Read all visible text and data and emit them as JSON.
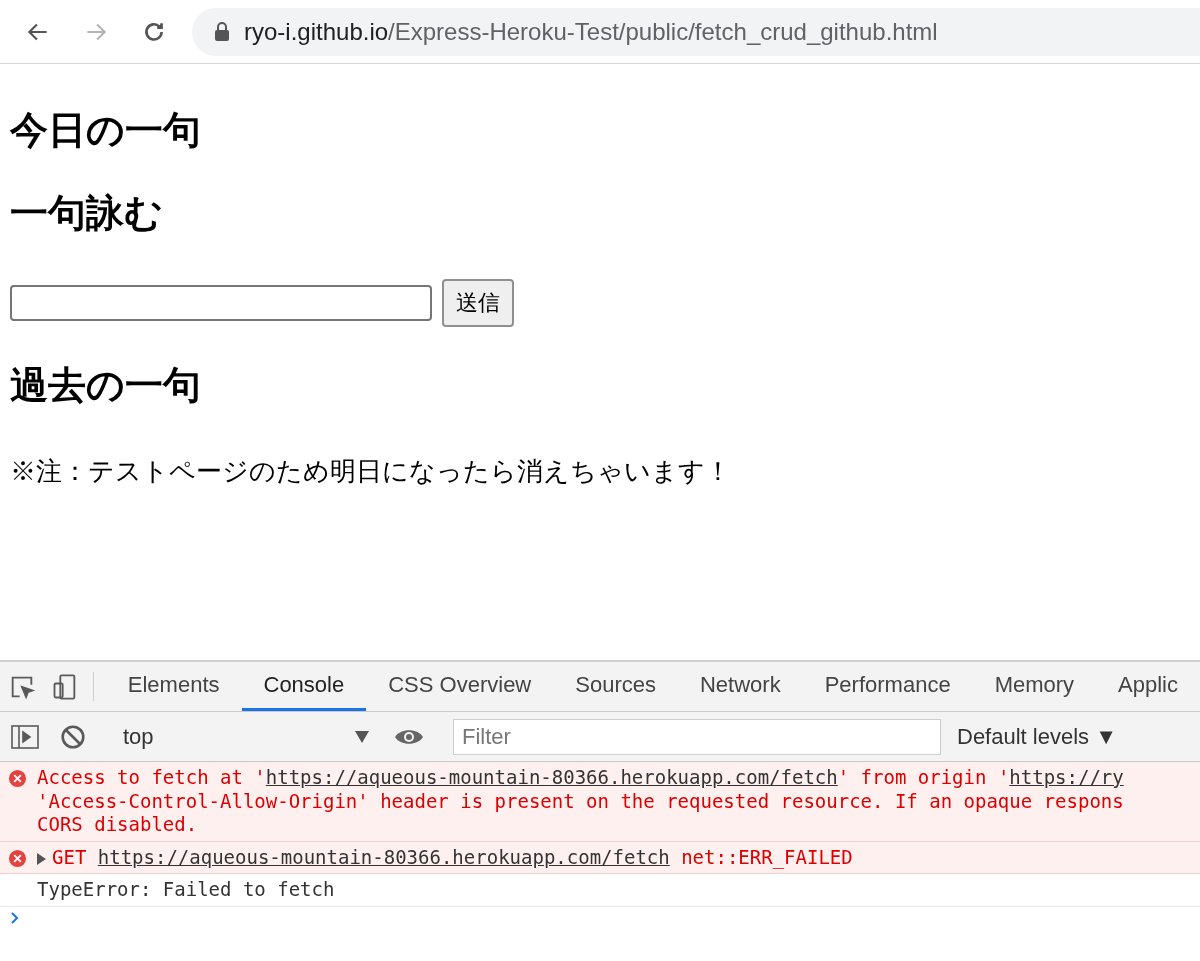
{
  "browser": {
    "url_host": "ryo-i.github.io",
    "url_path": "/Express-Heroku-Test/public/fetch_crud_github.html",
    "back_disabled": false,
    "forward_disabled": true
  },
  "page": {
    "title": "今日の一句",
    "form_heading": "一句詠む",
    "submit": "送信",
    "past_heading": "過去の一句",
    "note": "※注：テストページのため明日になったら消えちゃいます！"
  },
  "devtools": {
    "tabs": [
      {
        "label": "Elements",
        "selected": false
      },
      {
        "label": "Console",
        "selected": true
      },
      {
        "label": "CSS Overview",
        "selected": false
      },
      {
        "label": "Sources",
        "selected": false
      },
      {
        "label": "Network",
        "selected": false
      },
      {
        "label": "Performance",
        "selected": false
      },
      {
        "label": "Memory",
        "selected": false
      },
      {
        "label": "Applic",
        "selected": false
      }
    ],
    "context": "top",
    "filter": {
      "placeholder": "Filter"
    },
    "levels": "Default levels ▼",
    "messages": [
      {
        "kind": "error",
        "expandable": false,
        "lines": [
          [
            {
              "t": "Access to fetch at '"
            },
            {
              "t": "https://aqueous-mountain-80366.herokuapp.com/fetch",
              "link": true
            },
            {
              "t": "' from origin '"
            },
            {
              "t": "https://ry",
              "link": true
            }
          ],
          [
            {
              "t": "'Access-Control-Allow-Origin' header is present on the requested resource. If an opaque respons"
            }
          ],
          [
            {
              "t": "CORS disabled."
            }
          ]
        ]
      },
      {
        "kind": "error",
        "expandable": true,
        "lines": [
          [
            {
              "t": "GET "
            },
            {
              "t": "https://aqueous-mountain-80366.herokuapp.com/fetch",
              "link": true
            },
            {
              "t": " net::ERR_FAILED"
            }
          ]
        ]
      },
      {
        "kind": "log",
        "expandable": false,
        "lines": [
          [
            {
              "t": "TypeError: Failed to fetch"
            }
          ]
        ]
      }
    ]
  }
}
